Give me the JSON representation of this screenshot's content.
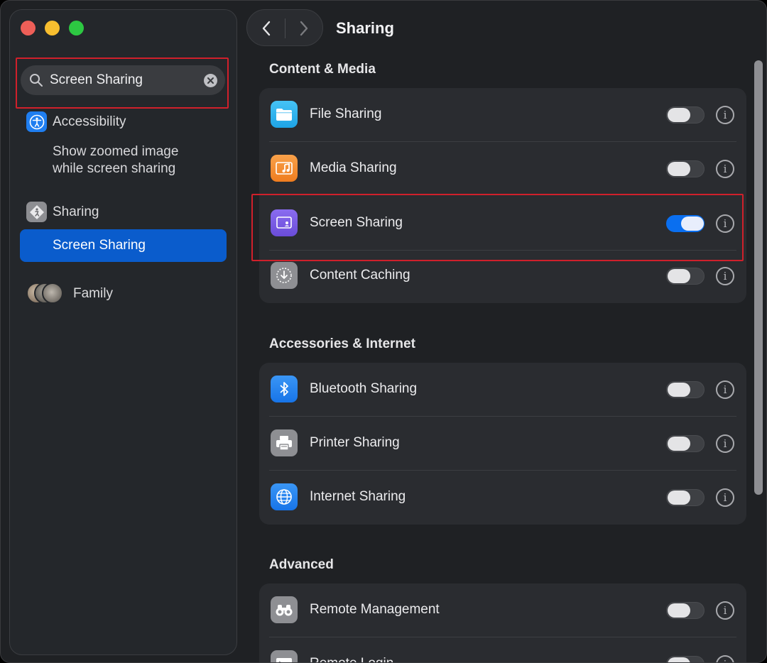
{
  "window": {
    "title": "Sharing"
  },
  "sidebar": {
    "search": {
      "value": "Screen Sharing",
      "placeholder": "Search"
    },
    "results": [
      {
        "label": "Accessibility",
        "icon": "accessibility-icon",
        "sub": [
          "Show zoomed image",
          "while screen sharing"
        ]
      },
      {
        "label": "Sharing",
        "icon": "sharing-icon",
        "sub_selected": "Screen Sharing"
      },
      {
        "label": "Family",
        "icon": "family-avatars"
      }
    ]
  },
  "sections": [
    {
      "title": "Content & Media",
      "items": [
        {
          "label": "File Sharing",
          "icon": "folder-icon",
          "enabled": false
        },
        {
          "label": "Media Sharing",
          "icon": "music-icon",
          "enabled": false
        },
        {
          "label": "Screen Sharing",
          "icon": "screen-sharing-icon",
          "enabled": true
        },
        {
          "label": "Content Caching",
          "icon": "download-icon",
          "enabled": false
        }
      ]
    },
    {
      "title": "Accessories & Internet",
      "items": [
        {
          "label": "Bluetooth Sharing",
          "icon": "bluetooth-icon",
          "enabled": false
        },
        {
          "label": "Printer Sharing",
          "icon": "printer-icon",
          "enabled": false
        },
        {
          "label": "Internet Sharing",
          "icon": "globe-icon",
          "enabled": false
        }
      ]
    },
    {
      "title": "Advanced",
      "items": [
        {
          "label": "Remote Management",
          "icon": "binoculars-icon",
          "enabled": false
        },
        {
          "label": "Remote Login",
          "icon": "terminal-icon",
          "enabled": false
        }
      ]
    }
  ],
  "colors": {
    "accent": "#0a6ff0",
    "highlight_box": "#d0202b",
    "selection": "#0a5ccc"
  }
}
